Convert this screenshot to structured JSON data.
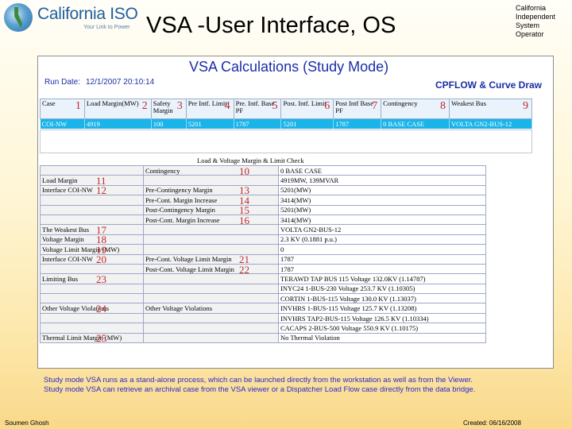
{
  "header": {
    "logo_name": "California ISO",
    "logo_tagline": "Your Link to Power",
    "title": "VSA -User Interface, OS",
    "org_name": "California Independent System Operator"
  },
  "panel": {
    "title": "VSA Calculations (Study Mode)",
    "run_date_label": "Run Date:",
    "run_date": "12/1/2007 20:10:14",
    "cpflow_label": "CPFLOW & Curve Draw"
  },
  "summary": {
    "headers": [
      "Case",
      "Load Margin(MW)",
      "Safety Margin",
      "Pre Intf. Limit",
      "Pre. Intf. Base PF",
      "Post. Intf. Limit",
      "Post Intf Base PF",
      "Contingency",
      "Weakest Bus"
    ],
    "markers": [
      "1",
      "2",
      "3",
      "4",
      "5",
      "6",
      "7",
      "8",
      "9"
    ],
    "row": [
      "COI-NW",
      "4919",
      "100",
      "5201",
      "1787",
      "5201",
      "1787",
      "0 BASE CASE",
      "VOLTA   GN2-BUS-12"
    ]
  },
  "lvm": {
    "title": "Load & Voltage Margin & Limit Check",
    "rows": [
      {
        "c1": "",
        "c1n": "",
        "c2": "Contingency",
        "c2n": "10",
        "c3": "0 BASE CASE"
      },
      {
        "c1": "Load Margin",
        "c1n": "11",
        "c2": "",
        "c2n": "",
        "c3": "4919MW, 139MVAR"
      },
      {
        "c1": "Interface COI-NW",
        "c1n": "12",
        "c2": "Pre-Contingency Margin",
        "c2n": "13",
        "c3": "5201(MW)"
      },
      {
        "c1": "",
        "c1n": "",
        "c2": "Pre-Cont. Margin Increase",
        "c2n": "14",
        "c3": "3414(MW)"
      },
      {
        "c1": "",
        "c1n": "",
        "c2": "Post-Contingency Margin",
        "c2n": "15",
        "c3": "5201(MW)"
      },
      {
        "c1": "",
        "c1n": "",
        "c2": "Post-Cont. Margin Increase",
        "c2n": "16",
        "c3": "3414(MW)"
      },
      {
        "c1": "The Weakest Bus",
        "c1n": "17",
        "c2": "",
        "c2n": "",
        "c3": "VOLTA   GN2-BUS-12"
      },
      {
        "c1": "Voltage Margin",
        "c1n": "18",
        "c2": "",
        "c2n": "",
        "c3": "2.3 KV (0.1881 p.u.)"
      },
      {
        "c1": "Voltage Limit Margin (MW)",
        "c1n": "19",
        "c2": "",
        "c2n": "",
        "c3": "0"
      },
      {
        "c1": "Interface COI-NW",
        "c1n": "20",
        "c2": "Pre-Cont. Voltage Limit Margin",
        "c2n": "21",
        "c3": "1787"
      },
      {
        "c1": "",
        "c1n": "",
        "c2": "Post-Cont. Voltage Limit Margin",
        "c2n": "22",
        "c3": "1787"
      },
      {
        "c1": "Limiting Bus",
        "c1n": "23",
        "c2": "",
        "c2n": "",
        "c3": "TERAWD   TAP BUS 115 Voltage 132.0KV (1.14787)"
      },
      {
        "c1": "",
        "c1n": "",
        "c2": "",
        "c2n": "",
        "c3": "INYC24   1-BUS-230  Voltage  253.7 KV (1.10305)"
      },
      {
        "c1": "",
        "c1n": "",
        "c2": "",
        "c2n": "",
        "c3": "CORTIN   1-BUS-115  Voltage  130.0 KV (1.13037)"
      },
      {
        "c1": "Other Voltage Violations",
        "c1n": "24",
        "c2": "Other Voltage Violations",
        "c2n": "",
        "c3": "INVHRS   1-BUS-115  Voltage  125.7 KV (1.13208)"
      },
      {
        "c1": "",
        "c1n": "",
        "c2": "",
        "c2n": "",
        "c3": "INVHRS   TAP2-BUS-115  Voltage  126.5 KV (1.10334)"
      },
      {
        "c1": "",
        "c1n": "",
        "c2": "",
        "c2n": "",
        "c3": "CACAPS   2-BUS-500  Voltage  550.9 KV (1.10175)"
      },
      {
        "c1": "Thermal Limit Margin (MW)",
        "c1n": "25",
        "c2": "",
        "c2n": "",
        "c3": "No Thermal Violation"
      }
    ]
  },
  "note": {
    "line1": "Study mode VSA runs as a stand-alone process, which can be launched directly from the workstation as well as from the Viewer.",
    "line2": "Study mode VSA can retrieve an archival case from the VSA viewer or a Dispatcher Load Flow case directly from the data bridge."
  },
  "footer": {
    "author": "Soumen Ghosh",
    "created": "Created: 06/16/2008"
  }
}
